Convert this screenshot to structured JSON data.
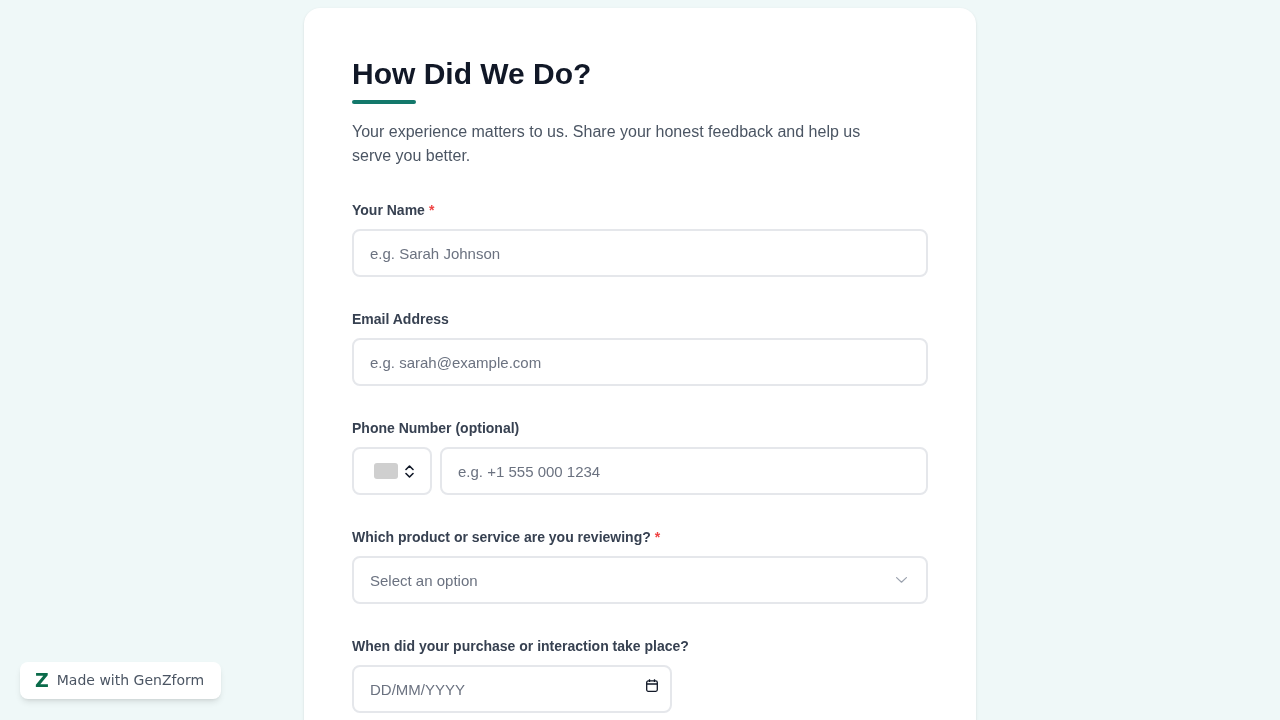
{
  "form": {
    "title": "How Did We Do?",
    "description": "Your experience matters to us. Share your honest feedback and help us serve you better.",
    "fields": [
      {
        "kind": "text",
        "label": "Your Name",
        "required_mark": "*",
        "placeholder": "e.g. Sarah Johnson"
      },
      {
        "kind": "text",
        "label": "Email Address",
        "placeholder": "e.g. sarah@example.com"
      },
      {
        "kind": "phone",
        "label": "Phone Number (optional)",
        "placeholder": "e.g. +1 555 000 1234"
      },
      {
        "kind": "select",
        "label": "Which product or service are you reviewing?",
        "required_mark": "*",
        "placeholder": "Select an option"
      },
      {
        "kind": "date",
        "label": "When did your purchase or interaction take place?",
        "placeholder": "DD/MM/YYYY"
      }
    ]
  },
  "badge": {
    "logo": "Z",
    "text": "Made with GenZform"
  }
}
